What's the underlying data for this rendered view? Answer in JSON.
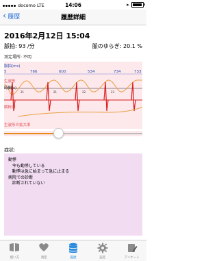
{
  "status": {
    "carrier": "docomo",
    "network": "LTE",
    "time": "14:06"
  },
  "nav": {
    "back_label": "履歴",
    "title": "履歴詳細"
  },
  "record": {
    "datetime": "2016年2月12日 15:04",
    "pulse": "脈拍: 93 /分",
    "yuragi": "脈のゆらぎ: 20.1 %",
    "place": "測定場所: 不明"
  },
  "chart": {
    "interval_label": "脈拍(ms)",
    "interval_values": [
      "5",
      "766",
      "600",
      "534",
      "734",
      "733"
    ],
    "raw_label": "生波形",
    "time_label": "時間(s)",
    "time_values": [
      "21",
      "21",
      "22",
      "23"
    ],
    "analysis_label": "解析図",
    "zoom_label": "生波形の拡大率",
    "colors": {
      "wave": "#e8a040",
      "spike": "#d81b1b",
      "label": "#e05050",
      "text_blue": "#2a4fb0"
    }
  },
  "slider": {
    "value_fraction": 0.37
  },
  "symptom": {
    "label": "症状:",
    "text": "動悸\n   今も動悸している\n   動悸は急に始まって急に止まる\n病院での診断\n   診断されていない"
  },
  "tabs": [
    {
      "label": "使い方",
      "icon": "book-icon"
    },
    {
      "label": "測定",
      "icon": "heart-icon"
    },
    {
      "label": "履歴",
      "icon": "database-icon",
      "active": true
    },
    {
      "label": "設定",
      "icon": "gear-icon"
    },
    {
      "label": "アンケート",
      "icon": "survey-icon"
    }
  ]
}
